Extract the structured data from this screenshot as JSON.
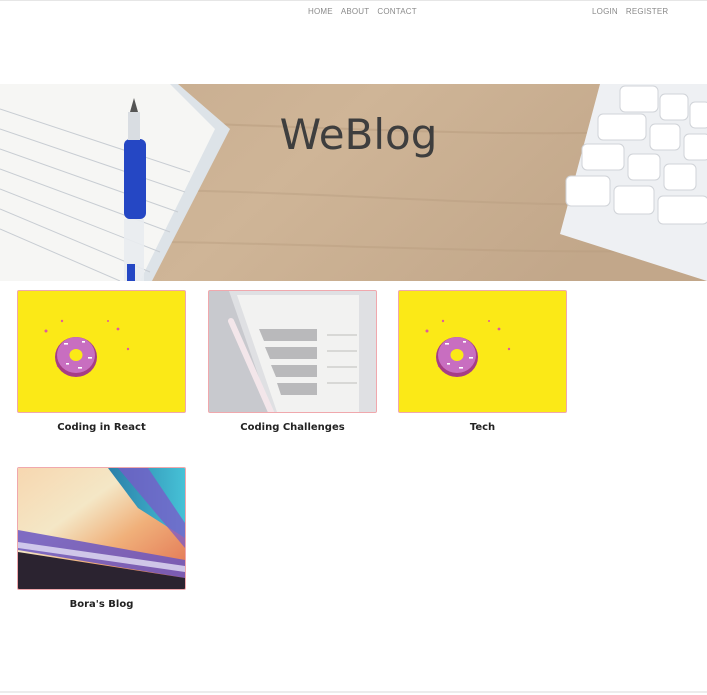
{
  "header": {
    "nav_left": [
      "HOME",
      "ABOUT",
      "CONTACT"
    ],
    "nav_right": [
      "LOGIN",
      "REGISTER"
    ]
  },
  "hero": {
    "title": "WeBlog"
  },
  "posts": [
    {
      "title": "Coding in React",
      "image": "donut-on-yellow"
    },
    {
      "title": "Coding Challenges",
      "image": "weekly-planner"
    },
    {
      "title": "Tech",
      "image": "donut-on-yellow"
    },
    {
      "title": "Bora's Blog",
      "image": "abstract-colors"
    }
  ]
}
